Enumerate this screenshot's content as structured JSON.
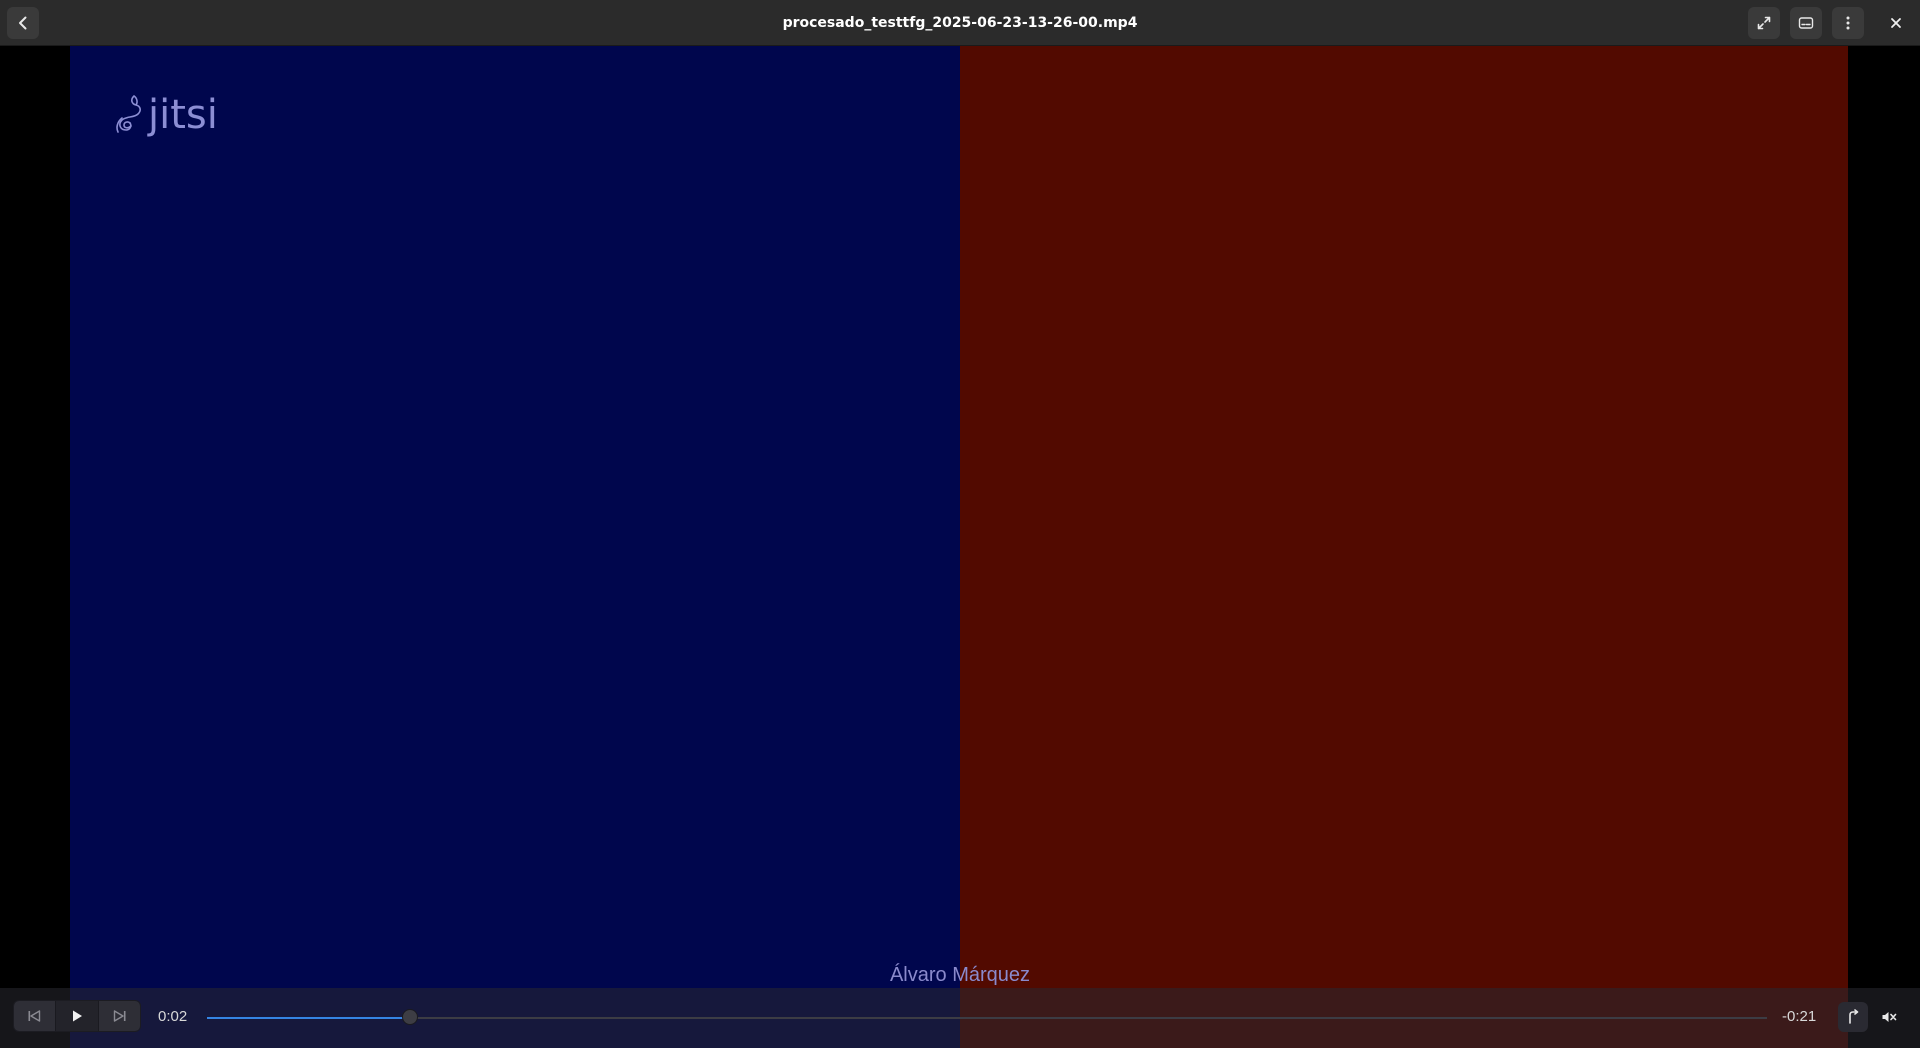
{
  "header": {
    "title": "procesado_testtfg_2025-06-23-13-26-00.mp4",
    "buttons": {
      "back": "go-back-icon",
      "fullscreen": "fullscreen-icon",
      "subtitles": "subtitles-icon",
      "menu": "more-options-icon",
      "close": "close-icon"
    }
  },
  "video": {
    "logo_text": "jitsi",
    "speaker_name": "Álvaro Márquez",
    "left_color": "#00064d",
    "right_color": "#520a00"
  },
  "controls": {
    "elapsed": "0:02",
    "remaining": "-0:21",
    "progress_fraction": 0.13,
    "accent": "#3584e4",
    "icons": {
      "previous": "skip-previous-icon",
      "play": "play-icon",
      "next": "skip-next-icon",
      "speed": "playback-speed-icon",
      "mute": "volume-muted-icon"
    }
  }
}
